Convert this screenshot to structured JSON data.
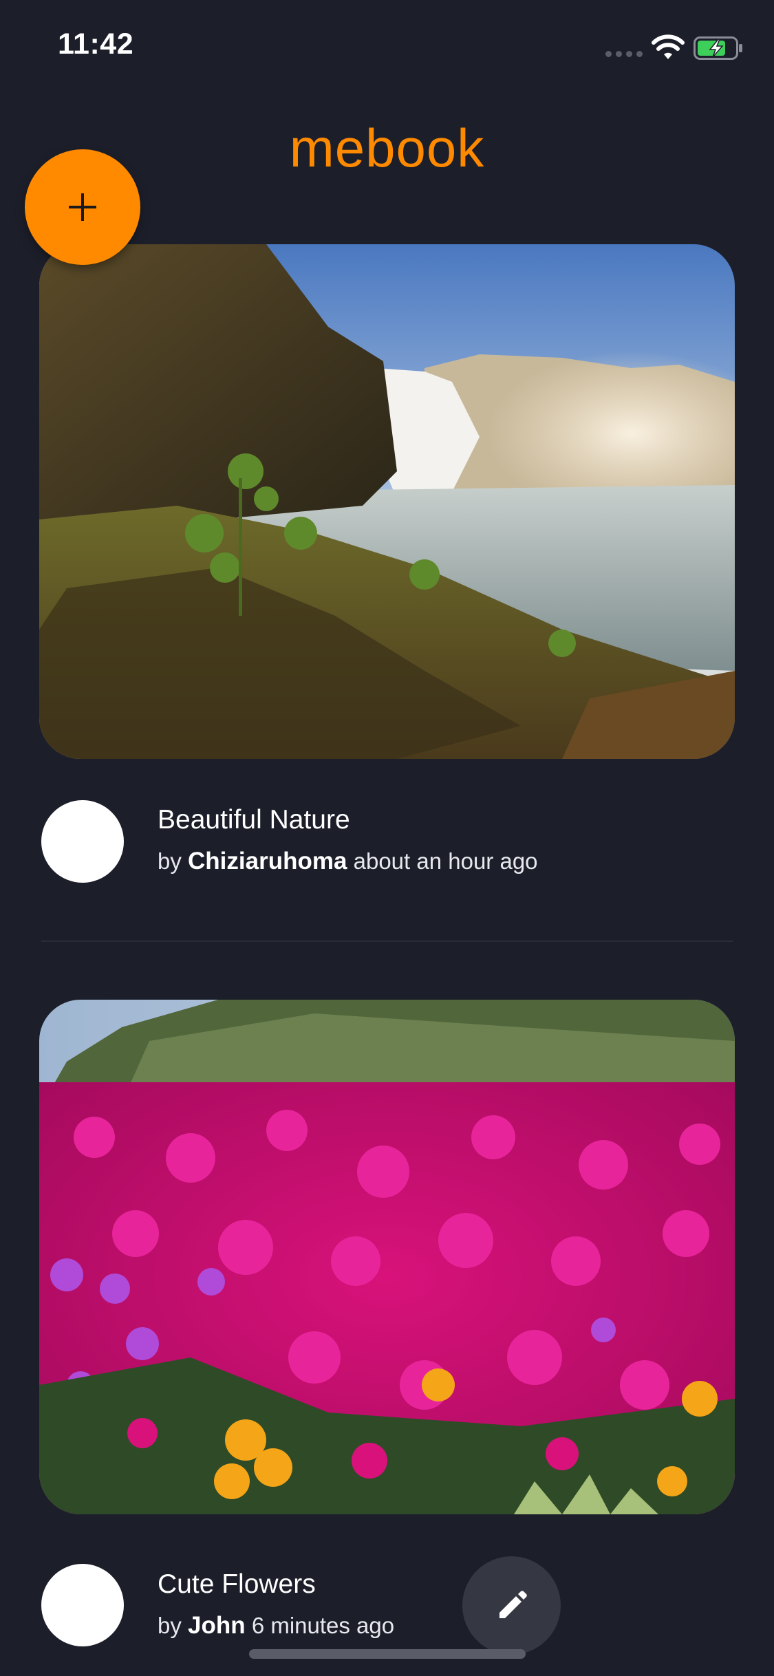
{
  "status_bar": {
    "time": "11:42",
    "icons": [
      "signal-dots-icon",
      "wifi-icon",
      "battery-charging-icon"
    ]
  },
  "header": {
    "brand": "mebook",
    "add_icon": "plus-icon"
  },
  "colors": {
    "background": "#1c1f2a",
    "accent": "#ff8a00",
    "divider": "#2a2d39",
    "fab_secondary": "#353843"
  },
  "posts": [
    {
      "image": "waterfall-landscape-photo",
      "title": "Beautiful Nature",
      "by": "by",
      "author": "Chiziaruhoma",
      "time": "about an hour ago"
    },
    {
      "image": "pink-flowers-photo",
      "title": "Cute Flowers",
      "by": "by",
      "author": "John",
      "time": "6 minutes ago"
    }
  ],
  "fab": {
    "icon": "pencil-icon"
  }
}
